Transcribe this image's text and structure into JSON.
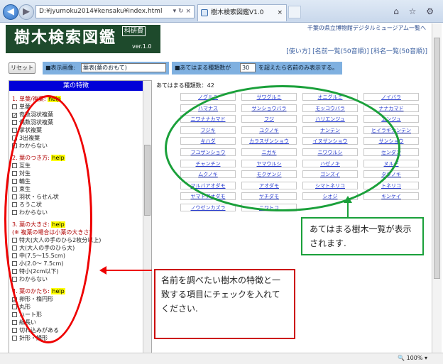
{
  "browser": {
    "address": "D:¥jyumoku2014¥kensaku¥index.html",
    "address_tail": "▾ ↻ ×",
    "tab_title": "樹木検索図鑑V1.0",
    "tab_close": "×",
    "toolbar_icons": "⌂ ☆ ⚙"
  },
  "header": {
    "logo_title": "樹木検索図鑑",
    "logo_badge": "科研費",
    "logo_version": "ver.1.0",
    "museum_link": "千葉の県立博物館デジタルミュージアム一覧へ",
    "nav": "[使い方] [名前一覧(50音順)] [科名一覧(50音順)]"
  },
  "controls": {
    "reset_label": "リセット",
    "display_label": "■表示画像:",
    "display_value": "葉表(葉のおもて)",
    "count_label": "■あてはまる種類数が",
    "count_value": "30",
    "count_suffix": "を超えたら名前のみ表示する。"
  },
  "left": {
    "heading": "葉の特徴",
    "help": "help",
    "sections": [
      {
        "title": "1. 単葉/複葉:",
        "sub": "",
        "options": [
          {
            "label": "単葉",
            "checked": false
          },
          {
            "label": "奇数羽状複葉",
            "checked": true
          },
          {
            "label": "偶数羽状複葉",
            "checked": false
          },
          {
            "label": "掌状複葉",
            "checked": false
          },
          {
            "label": "3出複葉",
            "checked": false
          },
          {
            "label": "わからない",
            "checked": false
          }
        ]
      },
      {
        "title": "2. 葉のつき方:",
        "sub": "",
        "options": [
          {
            "label": "互生",
            "checked": false
          },
          {
            "label": "対生",
            "checked": false
          },
          {
            "label": "輪生",
            "checked": false
          },
          {
            "label": "束生",
            "checked": false
          },
          {
            "label": "羽状・らせん状",
            "checked": false
          },
          {
            "label": "ろうこ状",
            "checked": false
          },
          {
            "label": "わからない",
            "checked": false
          }
        ]
      },
      {
        "title": "3. 葉の大きさ:",
        "sub": "(※ 複葉の場合は小葉の大きさ)",
        "options": [
          {
            "label": "特大(大人の手のひら2枚分以上)",
            "checked": false
          },
          {
            "label": "大(大人の手のひら大)",
            "checked": false
          },
          {
            "label": "中(7.5〜15.5cm)",
            "checked": false
          },
          {
            "label": "小(2.0〜 7.5cm)",
            "checked": false
          },
          {
            "label": "特小(2cm以下)",
            "checked": false
          },
          {
            "label": "わからない",
            "checked": false
          }
        ]
      },
      {
        "title": "4. 葉のかたち:",
        "sub": "",
        "options": [
          {
            "label": "卵形・楕円形",
            "checked": true
          },
          {
            "label": "丸形",
            "checked": false
          },
          {
            "label": "ハート形",
            "checked": false
          },
          {
            "label": "細長い",
            "checked": false
          },
          {
            "label": "切れ込みがある",
            "checked": false
          },
          {
            "label": "針形・鱗形",
            "checked": false
          }
        ]
      }
    ]
  },
  "right": {
    "count_text": "あてはまる種類数：42",
    "species": [
      "ノグルミ",
      "サワグルミ",
      "オニグルミ",
      "ノイバラ",
      "ハマナス",
      "サンショウバラ",
      "モッコウバラ",
      "ナナカマド",
      "ニワナナカマド",
      "フジ",
      "ハリエンジュ",
      "エンジュ",
      "フジキ",
      "ユクノキ",
      "ナンテン",
      "ヒイラギナンテン",
      "キハダ",
      "カラスザンショウ",
      "イヌザンショウ",
      "サンショウ",
      "フユザンショウ",
      "ニガキ",
      "ニワウルシ",
      "センダン",
      "チャンチン",
      "ヤマウルシ",
      "ハゼノキ",
      "ヌルデ",
      "ムクノキ",
      "モクゲンジ",
      "ゴンズイ",
      "タラノキ",
      "マルバアオダモ",
      "アオダモ",
      "シマトネリコ",
      "トネリコ",
      "ヤマトアオダモ",
      "ヤチダモ",
      "シオジ",
      "キンケイ",
      "ノウゼンカズラ",
      "ニワトコ"
    ]
  },
  "annotations": {
    "red_callout": "名前を調べたい樹木の特徴と一致する項目にチェックを入れてください.",
    "green_callout": "あてはまる樹木一覧が表示されます."
  },
  "status": {
    "zoom": "🔍 100%  ▾"
  }
}
